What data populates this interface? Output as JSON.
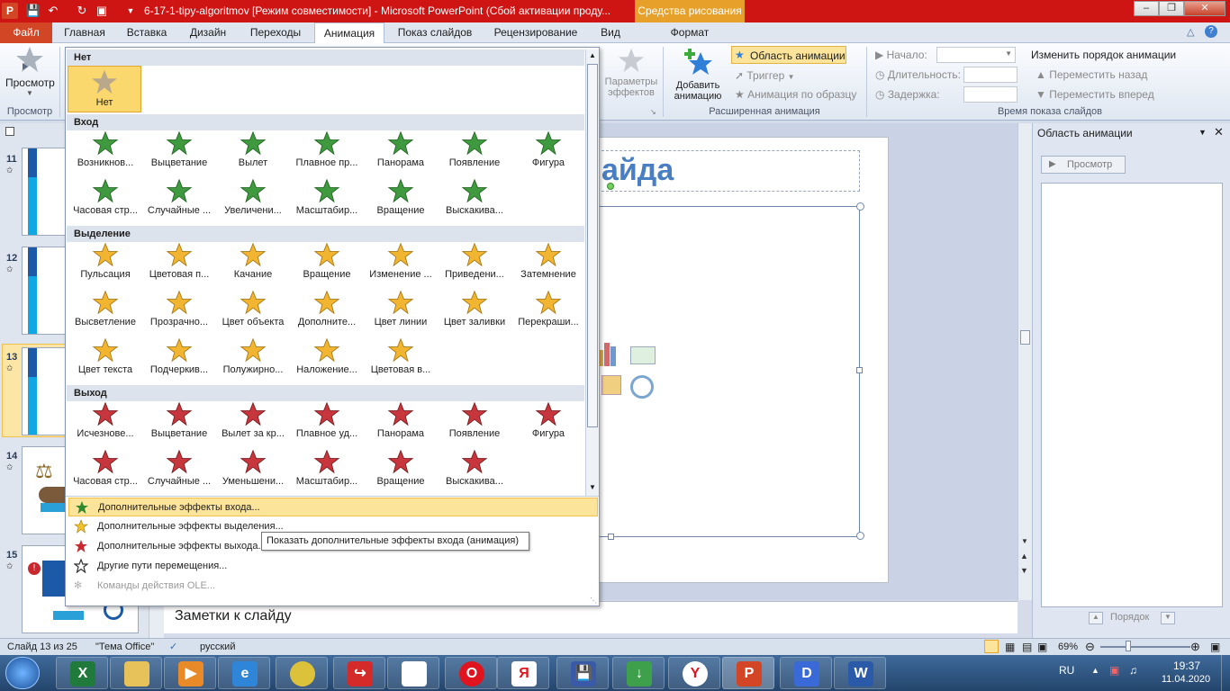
{
  "window": {
    "title": "6-17-1-tipy-algoritmov [Режим совместимости]  -  Microsoft PowerPoint (Сбой активации проду...",
    "context_tab": "Средства рисования",
    "app_icon": "P"
  },
  "tabs": [
    {
      "label": "Файл"
    },
    {
      "label": "Главная"
    },
    {
      "label": "Вставка"
    },
    {
      "label": "Дизайн"
    },
    {
      "label": "Переходы"
    },
    {
      "label": "Анимация"
    },
    {
      "label": "Показ слайдов"
    },
    {
      "label": "Рецензирование"
    },
    {
      "label": "Вид"
    },
    {
      "label": "Формат"
    }
  ],
  "ribbon": {
    "preview_label": "Просмотр",
    "preview_group": "Просмотр",
    "effect_params": "Параметры\nэффектов",
    "effect_params_l1": "Параметры",
    "effect_params_l2": "эффектов",
    "add_anim_l1": "Добавить",
    "add_anim_l2": "анимацию",
    "anim_pane": "Область анимации",
    "trigger": "Триггер",
    "anim_painter": "Анимация по образцу",
    "adv_group": "Расширенная анимация",
    "start": "Начало:",
    "duration": "Длительность:",
    "delay": "Задержка:",
    "timing_group": "Время показа слайдов",
    "reorder": "Изменить порядок анимации",
    "move_earlier": "Переместить назад",
    "move_later": "Переместить вперед"
  },
  "gallery": {
    "sections": {
      "none": "Нет",
      "entrance": "Вход",
      "emphasis": "Выделение",
      "exit": "Выход"
    },
    "none_items": [
      {
        "label": "Нет"
      }
    ],
    "entrance_row1": [
      {
        "label": "Возникнов..."
      },
      {
        "label": "Выцветание"
      },
      {
        "label": "Вылет"
      },
      {
        "label": "Плавное пр..."
      },
      {
        "label": "Панорама"
      },
      {
        "label": "Появление"
      },
      {
        "label": "Фигура"
      }
    ],
    "entrance_row2": [
      {
        "label": "Часовая стр..."
      },
      {
        "label": "Случайные ..."
      },
      {
        "label": "Увеличени..."
      },
      {
        "label": "Масштабир..."
      },
      {
        "label": "Вращение"
      },
      {
        "label": "Выскакива..."
      }
    ],
    "emphasis_row1": [
      {
        "label": "Пульсация"
      },
      {
        "label": "Цветовая п..."
      },
      {
        "label": "Качание"
      },
      {
        "label": "Вращение"
      },
      {
        "label": "Изменение ..."
      },
      {
        "label": "Приведени..."
      },
      {
        "label": "Затемнение"
      }
    ],
    "emphasis_row2": [
      {
        "label": "Высветление"
      },
      {
        "label": "Прозрачно..."
      },
      {
        "label": "Цвет объекта"
      },
      {
        "label": "Дополните..."
      },
      {
        "label": "Цвет линии"
      },
      {
        "label": "Цвет заливки"
      },
      {
        "label": "Перекраши..."
      }
    ],
    "emphasis_row3": [
      {
        "label": "Цвет текста"
      },
      {
        "label": "Подчеркив..."
      },
      {
        "label": "Полужирно..."
      },
      {
        "label": "Наложение..."
      },
      {
        "label": "Цветовая в..."
      }
    ],
    "exit_row1": [
      {
        "label": "Исчезнове..."
      },
      {
        "label": "Выцветание"
      },
      {
        "label": "Вылет за кр..."
      },
      {
        "label": "Плавное уд..."
      },
      {
        "label": "Панорама"
      },
      {
        "label": "Появление"
      },
      {
        "label": "Фигура"
      }
    ],
    "exit_row2": [
      {
        "label": "Часовая стр..."
      },
      {
        "label": "Случайные ..."
      },
      {
        "label": "Уменьшени..."
      },
      {
        "label": "Масштабир..."
      },
      {
        "label": "Вращение"
      },
      {
        "label": "Выскакива..."
      }
    ],
    "more": [
      "Дополнительные эффекты входа...",
      "Дополнительные эффекты выделения...",
      "Дополнительные эффекты выхода...",
      "Другие пути перемещения...",
      "Команды действия OLE..."
    ],
    "tooltip": "Показать дополнительные эффекты входа (анимация)"
  },
  "slides": [
    {
      "num": "11"
    },
    {
      "num": "12"
    },
    {
      "num": "13"
    },
    {
      "num": "14"
    },
    {
      "num": "15"
    }
  ],
  "slide_title_fragment": "айда",
  "notes_placeholder": "Заметки к слайду",
  "anim_pane": {
    "title": "Область анимации",
    "preview": "Просмотр",
    "order": "Порядок"
  },
  "status": {
    "slide": "Слайд 13 из 25",
    "theme": "\"Тема Office\"",
    "lang": "русский",
    "zoom": "69%"
  },
  "taskbar": {
    "lang": "RU",
    "time": "19:37",
    "date": "11.04.2020"
  },
  "colors": {
    "titlebar": "#cf1414",
    "context": "#e7a12b",
    "file_tab": "#d24625",
    "entrance_green": "#3f9a3f",
    "emphasis_gold": "#f2b531",
    "exit_red": "#c8363d"
  }
}
